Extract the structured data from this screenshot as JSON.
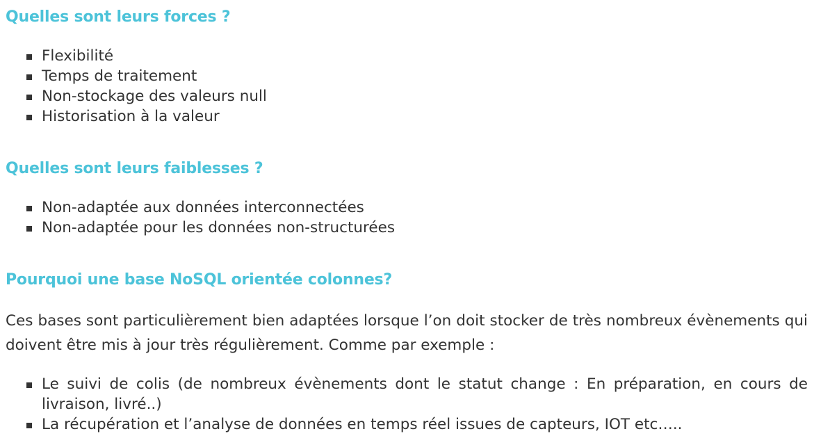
{
  "forces": {
    "heading": "Quelles sont leurs forces ?",
    "items": [
      "Flexibilité",
      "Temps de traitement",
      "Non-stockage des valeurs null",
      "Historisation à la valeur"
    ]
  },
  "faiblesses": {
    "heading": "Quelles sont leurs faiblesses ?",
    "items": [
      "Non-adaptée aux données interconnectées",
      "Non-adaptée pour les données non-structurées"
    ]
  },
  "pourquoi": {
    "heading": "Pourquoi une base NoSQL orientée colonnes?",
    "paragraph": "Ces bases sont particulièrement bien adaptées lorsque l’on doit stocker de très nombreux évènements qui doivent être mis à jour très régulièrement. Comme par exemple :",
    "items": [
      "Le suivi de colis (de nombreux évènements dont le statut change : En préparation, en cours de livraison, livré..)",
      "La récupération et l’analyse de données en temps réel issues de capteurs, IOT etc….."
    ]
  },
  "colors": {
    "heading": "#4cc3d9",
    "text": "#333333"
  }
}
